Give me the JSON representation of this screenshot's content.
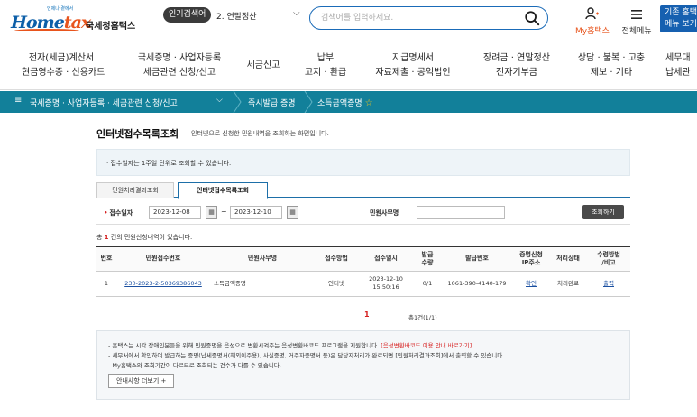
{
  "header": {
    "logo_tagline": "언제나 곁에서",
    "logo_home": "Home",
    "logo_tax": "tax",
    "logo_org": "국세청홈택스",
    "popular_badge": "인기검색어",
    "popular_item": "2.  연말정산",
    "search_placeholder": "검색어를 입력하세요.",
    "my_hometax": "My홈택스",
    "all_menu": "전체메뉴",
    "basic_menu_line1": "기존 홈택",
    "basic_menu_line2": "메뉴 보기"
  },
  "gnb": [
    {
      "l1": "전자(세금)계산서",
      "l2": "현금영수증 · 신용카드"
    },
    {
      "l1": "국세증명 · 사업자등록",
      "l2": "세금관련 신청/신고"
    },
    {
      "l1": "세금신고",
      "l2": ""
    },
    {
      "l1": "납부",
      "l2": "고지 · 환급"
    },
    {
      "l1": "지급명세서",
      "l2": "자료제출 · 공익법인"
    },
    {
      "l1": "장려금 · 연말정산",
      "l2": "전자기부금"
    },
    {
      "l1": "상담 · 불복 · 고충",
      "l2": "제보 · 기타"
    },
    {
      "l1": "세무대",
      "l2": "납세관"
    }
  ],
  "location": {
    "level1": "국세증명 · 사업자등록 · 세금관련 신청/신고",
    "level2": "즉시발급 증명",
    "level3": "소득금액증명"
  },
  "content": {
    "title": "인터넷접수목록조회",
    "title_desc": "인터넷으로 신청한 민원내역을 조회하는 화면입니다.",
    "top_notice": "·  접수일자는 1주일 단위로 조회할 수 있습니다.",
    "tabs": [
      "민원처리결과조회",
      "인터넷접수목록조회"
    ],
    "filter": {
      "date_label": "접수일자",
      "date_from": "2023-12-08",
      "date_to": "2023-12-10",
      "name_label": "민원사무명",
      "search_button": "조회하기"
    },
    "count_prefix": "총 ",
    "count_num": "1",
    "count_suffix": " 건의 민원신청내역이 있습니다.",
    "table": {
      "headers": [
        "번호",
        "민원접수번호",
        "민원사무명",
        "접수방법",
        "접수일시",
        "발급\n수량",
        "발급번호",
        "증명신청\nIP주소",
        "처리상태",
        "수령방법\n/비고"
      ],
      "rows": [
        {
          "no": "1",
          "receipt_no": "230-2023-2-50369386043",
          "service": "소득금액증명",
          "method": "인터넷",
          "datetime_1": "2023-12-10",
          "datetime_2": "15:50:16",
          "qty": "0/1",
          "issue_no": "1061-390-4140-179",
          "ip": "확인",
          "status": "처리완료",
          "receive": "출력"
        }
      ]
    },
    "pager_current": "1",
    "pager_total": "총1건(1/1)",
    "bottom_notice": {
      "line1_a": "- 홈택스는 시각 장애인분들을 위해 민원증명을 음성으로 변환시켜주는 음성변환바코드 프로그램을 지원합니다.",
      "line1_b": "[음성변환바코드 이용 안내 바로가기]",
      "line2": "- 세무서에서 확인하여 발급하는 증명(납세증명서(해외이주용), 사실증명, 거주자증명서 등)은 담당자처리가 완료되면 [민원처리결과조회]에서 출력할 수 있습니다.",
      "line3": "- My홈택스와 조회기간이 다르므로 조회되는 건수가 다를 수 있습니다.",
      "more_button": "안내사항 더보기 +"
    }
  },
  "colors": {
    "brand_blue": "#1660b0",
    "brand_orange": "#e8541c",
    "location_bar": "#12809a",
    "emphasis_red": "#d62020"
  }
}
